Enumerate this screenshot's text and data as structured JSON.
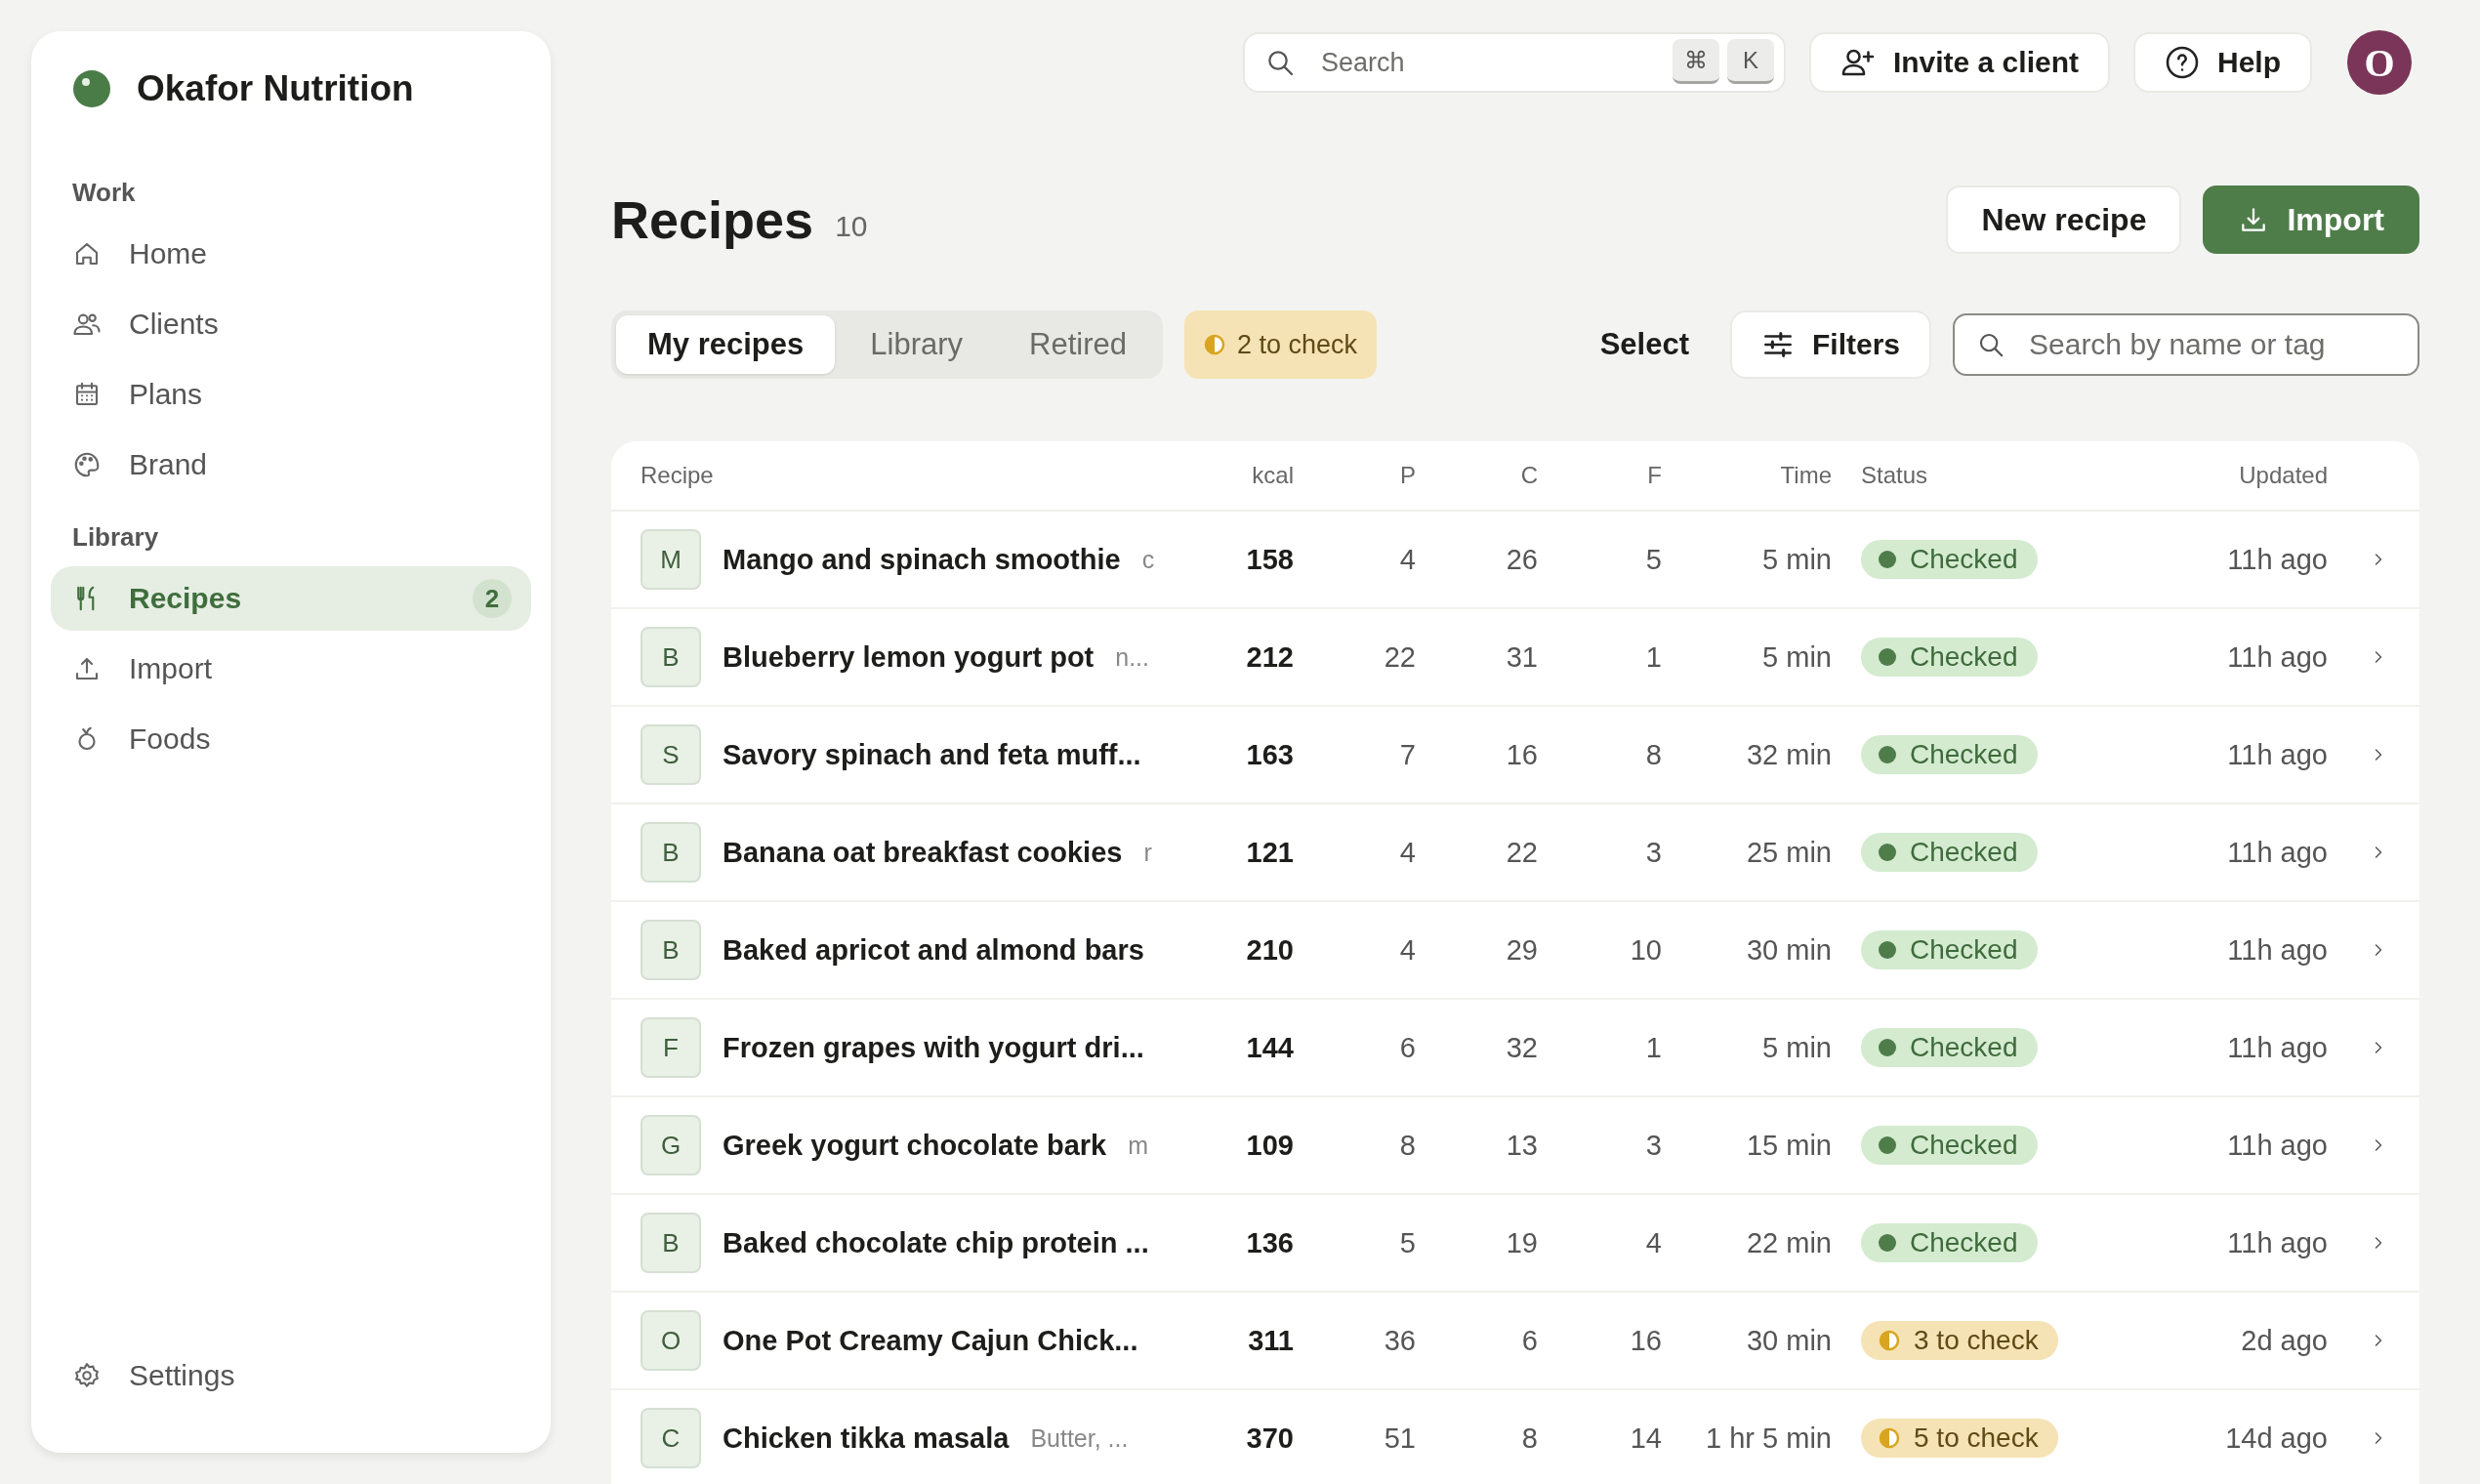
{
  "brand": {
    "name": "Okafor Nutrition"
  },
  "sidebar": {
    "sections": [
      {
        "label": "Work",
        "items": [
          {
            "label": "Home",
            "selected": false
          },
          {
            "label": "Clients",
            "selected": false
          },
          {
            "label": "Plans",
            "selected": false
          },
          {
            "label": "Brand",
            "selected": false
          }
        ]
      },
      {
        "label": "Library",
        "items": [
          {
            "label": "Recipes",
            "selected": true,
            "badge": "2"
          },
          {
            "label": "Import",
            "selected": false
          },
          {
            "label": "Foods",
            "selected": false
          }
        ]
      }
    ],
    "footer_item": {
      "label": "Settings"
    }
  },
  "topbar": {
    "search": {
      "placeholder": "Search",
      "shortcut_keys": [
        "⌘",
        "K"
      ]
    },
    "buttons": [
      {
        "label": "Invite a client"
      },
      {
        "label": "Help"
      }
    ],
    "avatar": {
      "initial": "O"
    }
  },
  "header": {
    "title": "Recipes",
    "count": "10",
    "buttons": [
      {
        "label": "New recipe",
        "kind": "secondary"
      },
      {
        "label": "Import",
        "kind": "primary"
      }
    ]
  },
  "tabs": [
    {
      "label": "My recipes",
      "selected": true
    },
    {
      "label": "Library",
      "selected": false
    },
    {
      "label": "Retired",
      "selected": false
    }
  ],
  "check_pill": {
    "label": "2 to check"
  },
  "toolbar": {
    "select": "Select",
    "filters": "Filters",
    "search": {
      "placeholder": "Search by name or tag"
    }
  },
  "table": {
    "columns": [
      "Recipe",
      "kcal",
      "P",
      "C",
      "F",
      "Time",
      "Status",
      "Updated"
    ],
    "rows": [
      {
        "initial": "M",
        "name": "Mango and spinach smoothie",
        "note": "c",
        "kcal": "158",
        "p": "4",
        "c": "26",
        "f": "5",
        "time": "5 min",
        "status": {
          "kind": "checked",
          "label": "Checked"
        },
        "updated": "11h ago"
      },
      {
        "initial": "B",
        "name": "Blueberry lemon yogurt pot",
        "note": "n...",
        "kcal": "212",
        "p": "22",
        "c": "31",
        "f": "1",
        "time": "5 min",
        "status": {
          "kind": "checked",
          "label": "Checked"
        },
        "updated": "11h ago"
      },
      {
        "initial": "S",
        "name": "Savory spinach and feta muff...",
        "kcal": "163",
        "p": "7",
        "c": "16",
        "f": "8",
        "time": "32 min",
        "status": {
          "kind": "checked",
          "label": "Checked"
        },
        "updated": "11h ago"
      },
      {
        "initial": "B",
        "name": "Banana oat breakfast cookies",
        "note": "r",
        "kcal": "121",
        "p": "4",
        "c": "22",
        "f": "3",
        "time": "25 min",
        "status": {
          "kind": "checked",
          "label": "Checked"
        },
        "updated": "11h ago"
      },
      {
        "initial": "B",
        "name": "Baked apricot and almond bars",
        "kcal": "210",
        "p": "4",
        "c": "29",
        "f": "10",
        "time": "30 min",
        "status": {
          "kind": "checked",
          "label": "Checked"
        },
        "updated": "11h ago"
      },
      {
        "initial": "F",
        "name": "Frozen grapes with yogurt dri...",
        "kcal": "144",
        "p": "6",
        "c": "32",
        "f": "1",
        "time": "5 min",
        "status": {
          "kind": "checked",
          "label": "Checked"
        },
        "updated": "11h ago"
      },
      {
        "initial": "G",
        "name": "Greek yogurt chocolate bark",
        "note": "m",
        "kcal": "109",
        "p": "8",
        "c": "13",
        "f": "3",
        "time": "15 min",
        "status": {
          "kind": "checked",
          "label": "Checked"
        },
        "updated": "11h ago"
      },
      {
        "initial": "B",
        "name": "Baked chocolate chip protein ...",
        "kcal": "136",
        "p": "5",
        "c": "19",
        "f": "4",
        "time": "22 min",
        "status": {
          "kind": "checked",
          "label": "Checked"
        },
        "updated": "11h ago"
      },
      {
        "initial": "O",
        "name": "One Pot Creamy Cajun Chick...",
        "kcal": "311",
        "p": "36",
        "c": "6",
        "f": "16",
        "time": "30 min",
        "status": {
          "kind": "to_check",
          "label": "3 to check"
        },
        "updated": "2d ago"
      },
      {
        "initial": "C",
        "name": "Chicken tikka masala",
        "note": "Butter, ...",
        "kcal": "370",
        "p": "51",
        "c": "8",
        "f": "14",
        "time": "1 hr 5 min",
        "status": {
          "kind": "to_check",
          "label": "5 to check"
        },
        "updated": "14d ago"
      }
    ]
  }
}
